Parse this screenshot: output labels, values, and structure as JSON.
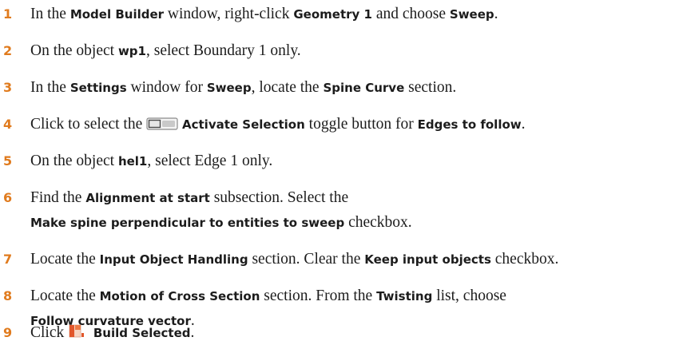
{
  "steps": [
    {
      "number": "1",
      "t1": "In the ",
      "b1": "Model Builder",
      "t2": " window, right-click ",
      "b2": "Geometry 1",
      "t3": " and choose ",
      "b3": "Sweep",
      "t4": "."
    },
    {
      "number": "2",
      "t1": "On the object ",
      "b1": "wp1",
      "t2": ", select Boundary 1 only."
    },
    {
      "number": "3",
      "t1": "In the ",
      "b1": "Settings",
      "t2": " window for ",
      "b2": "Sweep",
      "t3": ", locate the ",
      "b3": "Spine Curve",
      "t4": " section."
    },
    {
      "number": "4",
      "t1": "Click to select the ",
      "icon": "activate-selection-toggle-icon",
      "b1": "Activate Selection",
      "t2": " toggle button for ",
      "b2": "Edges to follow",
      "t3": "."
    },
    {
      "number": "5",
      "t1": "On the object ",
      "b1": "hel1",
      "t2": ", select Edge 1 only."
    },
    {
      "number": "6",
      "t1": "Find the ",
      "b1": "Alignment at start",
      "t2": " subsection. Select the",
      "b2": "Make spine perpendicular to entities to sweep",
      "t3": " checkbox."
    },
    {
      "number": "7",
      "t1": "Locate the ",
      "b1": "Input Object Handling",
      "t2": " section. Clear the ",
      "b2": "Keep input objects",
      "t3": " checkbox."
    },
    {
      "number": "8",
      "t1": "Locate the ",
      "b1": "Motion of Cross Section",
      "t2": " section. From the ",
      "b2": "Twisting",
      "t3": " list, choose",
      "b3": "Follow curvature vector",
      "t4": "."
    },
    {
      "number": "9",
      "t1": "Click ",
      "icon": "build-selected-icon",
      "b1": "Build Selected",
      "t2": "."
    }
  ],
  "colors": {
    "step_number": "#e07b1e",
    "text": "#1c1c1c"
  }
}
